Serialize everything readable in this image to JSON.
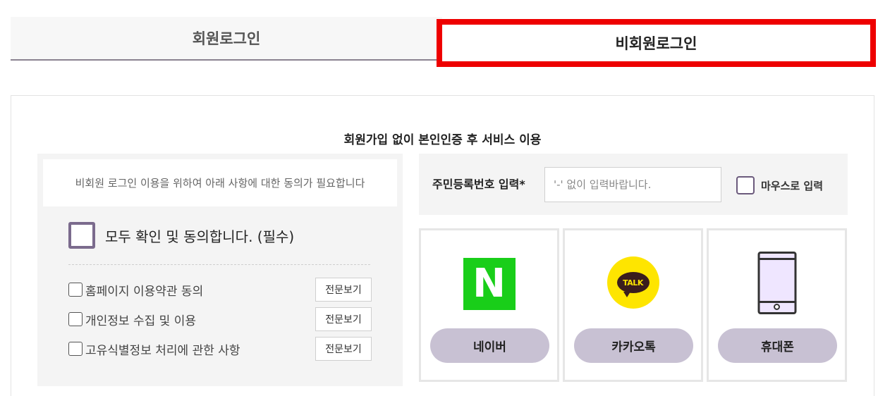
{
  "tabs": {
    "member_login": "회원로그인",
    "guest_login": "비회원로그인"
  },
  "panel": {
    "title": "회원가입 없이 본인인증 후 서비스 이용"
  },
  "agreement": {
    "notice": "비회원 로그인 이용을 위하여 아래 사항에 대한 동의가 필요합니다",
    "agree_all": "모두 확인 및 동의합니다. (필수)",
    "items": [
      {
        "label": "홈페이지 이용약관 동의",
        "button": "전문보기"
      },
      {
        "label": "개인정보 수집 및 이용",
        "button": "전문보기"
      },
      {
        "label": "고유식별정보 처리에 관한 사항",
        "button": "전문보기"
      }
    ]
  },
  "ssn": {
    "label": "주민등록번호 입력*",
    "placeholder": "'-' 없이 입력바랍니다.",
    "value": "",
    "mouse_input_label": "마우스로 입력"
  },
  "auth_methods": [
    {
      "icon": "naver-logo",
      "label": "네이버",
      "logo_text": "N"
    },
    {
      "icon": "kakaotalk-logo",
      "label": "카카오톡",
      "logo_text": "TALK"
    },
    {
      "icon": "mobile-phone-icon",
      "label": "휴대폰"
    }
  ],
  "colors": {
    "highlight_border": "#ee0000",
    "accent_purple": "#7b6b8d",
    "auth_button_bg": "#c8c1d3",
    "naver_green": "#19ce19",
    "kakao_yellow": "#fee500"
  }
}
